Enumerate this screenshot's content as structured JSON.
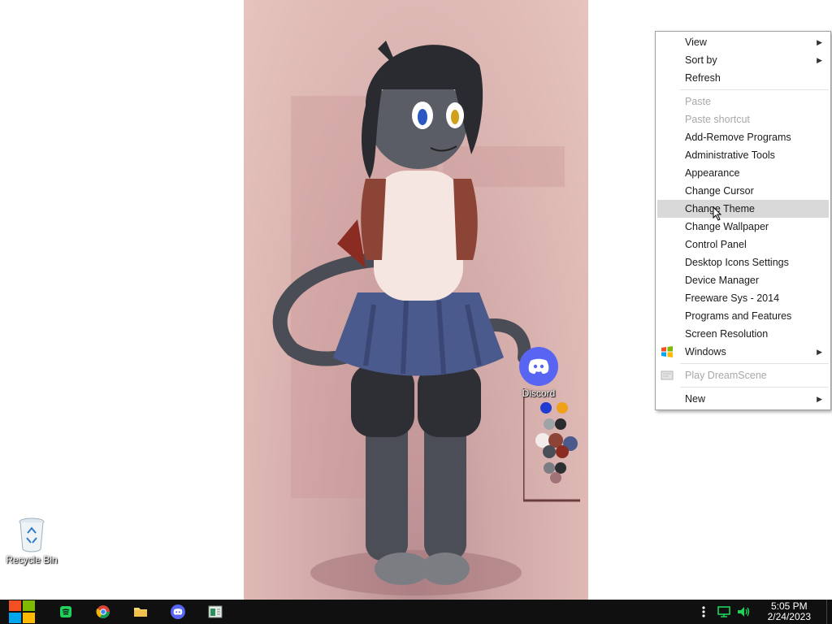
{
  "desktop": {
    "icons": [
      {
        "label": "Recycle Bin",
        "icon": "recycle-bin-icon"
      },
      {
        "label": "Discord",
        "icon": "discord-icon"
      }
    ]
  },
  "context_menu": {
    "items": [
      {
        "label": "View",
        "has_submenu": true
      },
      {
        "label": "Sort by",
        "has_submenu": true
      },
      {
        "label": "Refresh"
      },
      {
        "label": "Paste",
        "disabled": true
      },
      {
        "label": "Paste shortcut",
        "disabled": true
      },
      {
        "label": "Add-Remove Programs"
      },
      {
        "label": "Administrative Tools"
      },
      {
        "label": "Appearance"
      },
      {
        "label": "Change Cursor"
      },
      {
        "label": "Change Theme",
        "highlighted": true
      },
      {
        "label": "Change Wallpaper"
      },
      {
        "label": "Control Panel"
      },
      {
        "label": "Desktop Icons Settings"
      },
      {
        "label": "Device Manager"
      },
      {
        "label": "Freeware Sys - 2014"
      },
      {
        "label": "Programs and Features"
      },
      {
        "label": "Screen Resolution"
      },
      {
        "label": "Windows",
        "has_submenu": true,
        "icon": "windows-logo-icon"
      },
      {
        "label": "Play DreamScene",
        "disabled": true,
        "icon": "dreamscene-icon"
      },
      {
        "label": "New",
        "has_submenu": true
      }
    ]
  },
  "taskbar": {
    "pinned": [
      {
        "name": "start",
        "icon": "windows-start-icon"
      },
      {
        "name": "spotify",
        "icon": "spotify-icon"
      },
      {
        "name": "chrome",
        "icon": "chrome-icon"
      },
      {
        "name": "file-explorer",
        "icon": "folder-icon"
      },
      {
        "name": "discord",
        "icon": "discord-icon"
      },
      {
        "name": "app",
        "icon": "app-window-icon"
      }
    ],
    "tray": {
      "icons": [
        "overflow-dots-icon",
        "network-icon",
        "volume-icon"
      ]
    },
    "clock": {
      "time": "5:05 PM",
      "date": "2/24/2023"
    }
  },
  "colors": {
    "taskbar_bg": "#101010",
    "menu_highlight": "#d9d9d9",
    "discord_brand": "#5865f2",
    "tray_green": "#1fd35a"
  }
}
